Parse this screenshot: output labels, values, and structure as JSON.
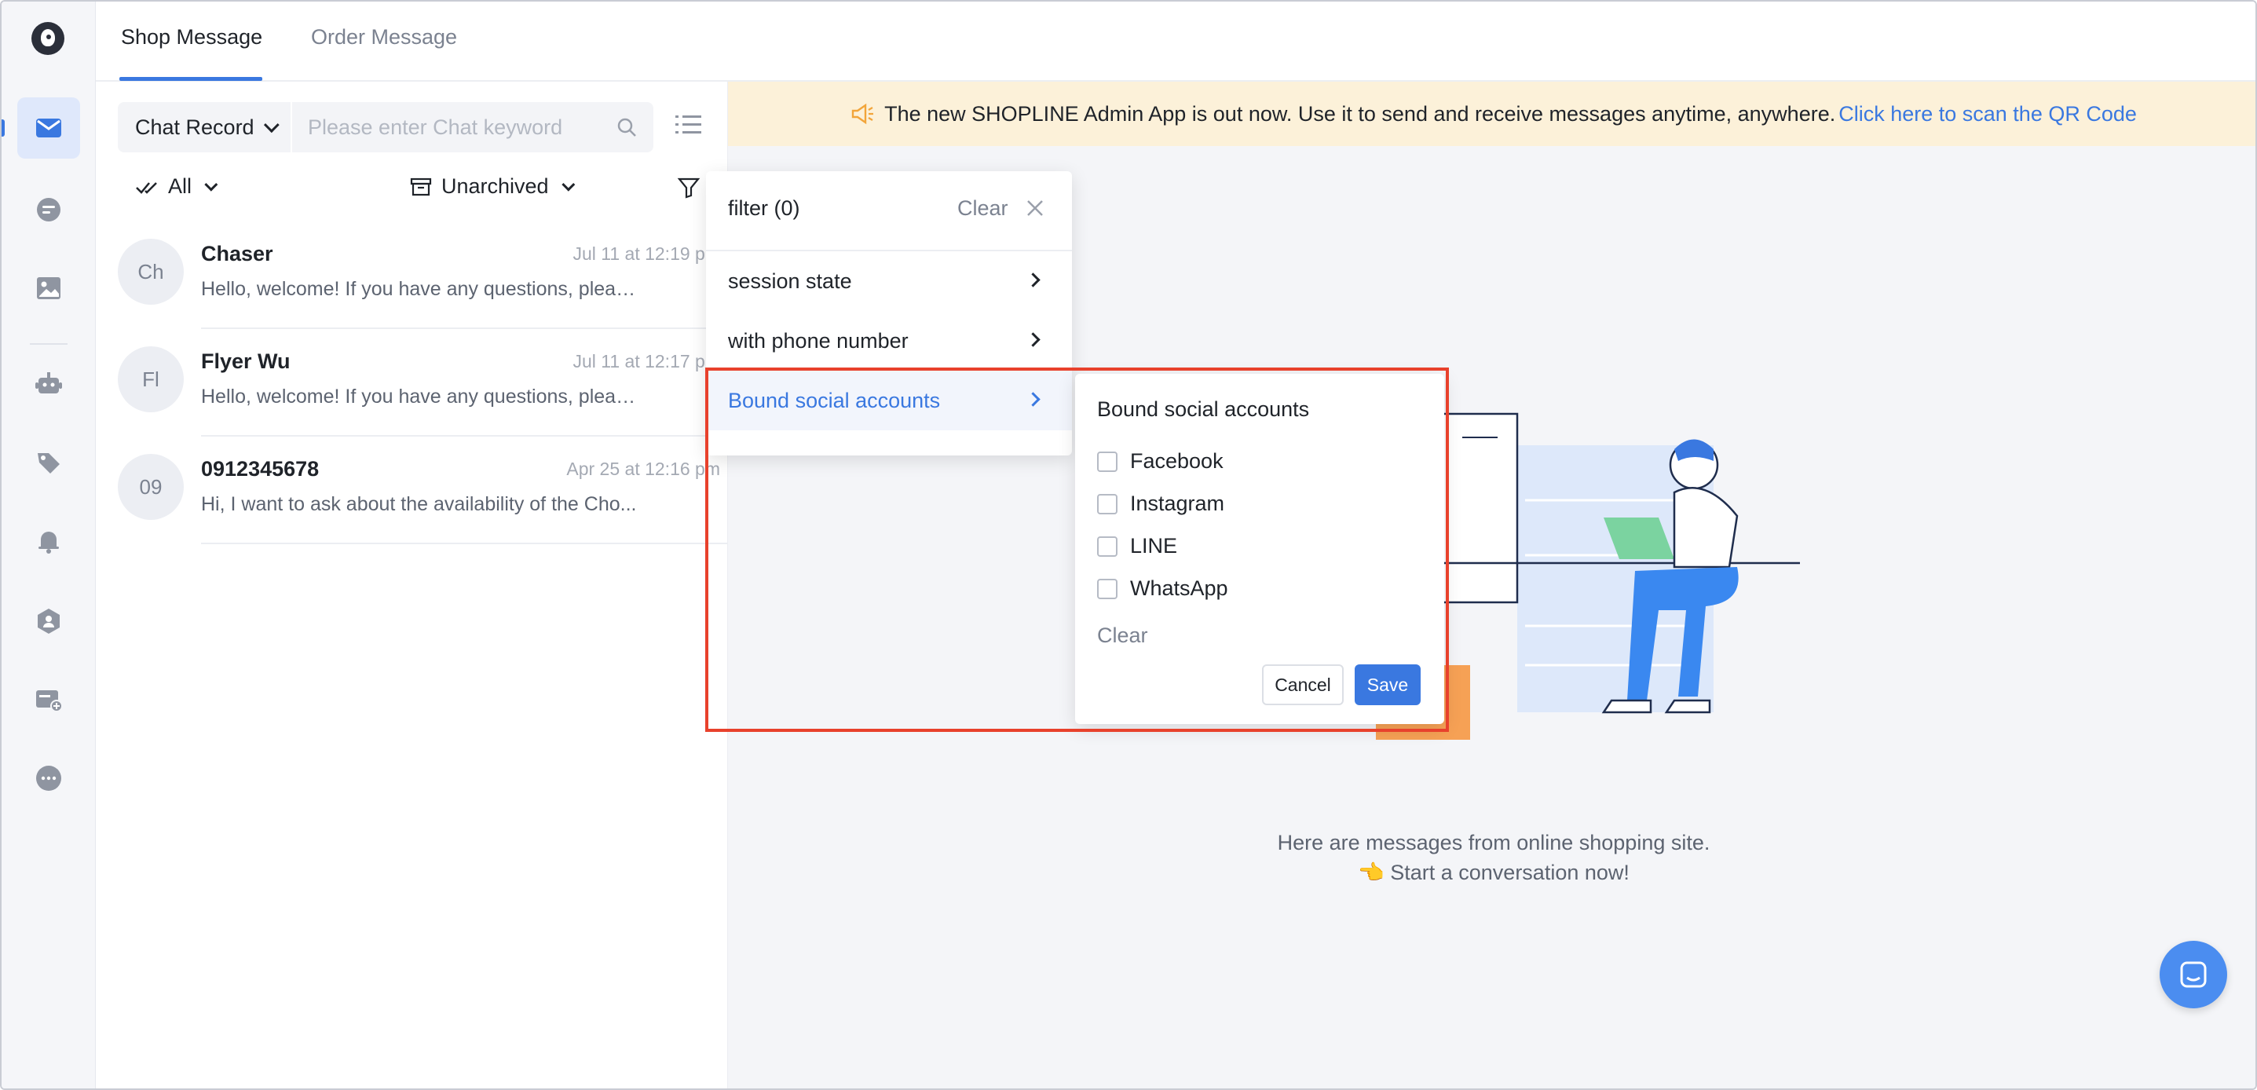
{
  "tabs": [
    {
      "label": "Shop Message",
      "active": true
    },
    {
      "label": "Order Message",
      "active": false
    }
  ],
  "sidebar": {
    "icons": [
      "inbox-icon",
      "chat-bubble-icon",
      "image-gallery-icon",
      "robot-icon",
      "tag-icon",
      "bell-icon",
      "shield-user-icon",
      "card-add-icon",
      "more-icon"
    ]
  },
  "search": {
    "scope": "Chat Record",
    "placeholder": "Please enter Chat keyword"
  },
  "filters": {
    "read_state": "All",
    "archive_state": "Unarchived"
  },
  "chats": [
    {
      "initials": "Ch",
      "name": "Chaser",
      "time": "Jul 11 at 12:19 pm",
      "preview": "Hello, welcome! If you have any questions, please..."
    },
    {
      "initials": "Fl",
      "name": "Flyer Wu",
      "time": "Jul 11 at 12:17 pm",
      "preview": "Hello, welcome! If you have any questions, please..."
    },
    {
      "initials": "09",
      "name": "0912345678",
      "time": "Apr 25 at 12:16 pm",
      "preview": "Hi, I want to ask about the availability of the Cho..."
    }
  ],
  "banner": {
    "text": "The new SHOPLINE Admin App is out now. Use it to send and receive messages anytime, anywhere.",
    "link": "Click here to scan the QR Code"
  },
  "empty_state": {
    "line1": "Here are messages from online shopping site.",
    "line2": "👈 Start a conversation now!"
  },
  "filter_popup": {
    "title": "filter (0)",
    "clear": "Clear",
    "items": [
      {
        "label": "session state"
      },
      {
        "label": "with phone number"
      },
      {
        "label": "Bound social accounts",
        "active": true
      }
    ]
  },
  "social_popup": {
    "title": "Bound social accounts",
    "options": [
      "Facebook",
      "Instagram",
      "LINE",
      "WhatsApp"
    ],
    "clear": "Clear",
    "cancel": "Cancel",
    "save": "Save"
  },
  "colors": {
    "accent": "#3a78e0",
    "banner_bg": "#fcf1d9",
    "highlight": "#e8412c"
  }
}
